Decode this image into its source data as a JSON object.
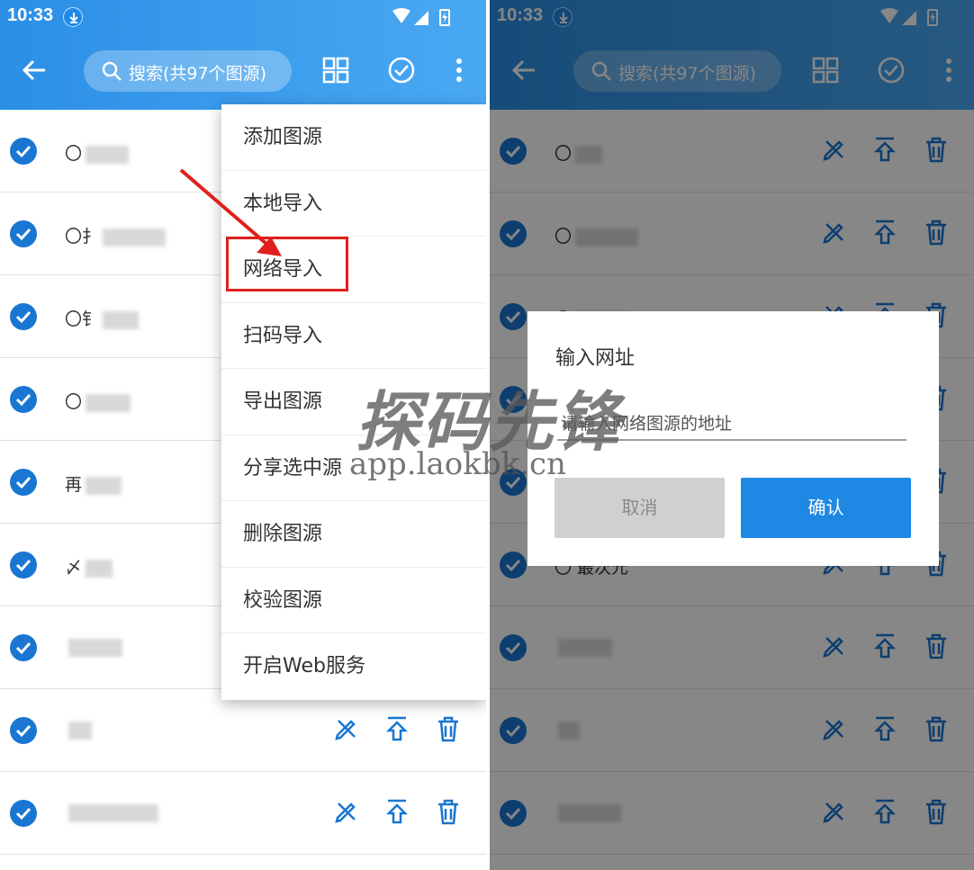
{
  "status": {
    "time": "10:33"
  },
  "search": {
    "placeholder": "搜索(共97个图源)"
  },
  "menu": {
    "items": [
      {
        "label": "添加图源"
      },
      {
        "label": "本地导入"
      },
      {
        "label": "网络导入"
      },
      {
        "label": "扫码导入"
      },
      {
        "label": "导出图源"
      },
      {
        "label": "分享选中源"
      },
      {
        "label": "删除图源"
      },
      {
        "label": "校验图源"
      },
      {
        "label": "开启Web服务"
      }
    ]
  },
  "left_rows": [
    {
      "name": "〇"
    },
    {
      "name": "〇扌"
    },
    {
      "name": "〇钅"
    },
    {
      "name": "〇"
    },
    {
      "name": "再"
    },
    {
      "name": "〆"
    },
    {
      "name": ""
    },
    {
      "name": ""
    },
    {
      "name": ""
    }
  ],
  "right_rows": [
    {
      "name": "〇"
    },
    {
      "name": "〇"
    },
    {
      "name": "〇"
    },
    {
      "name": ""
    },
    {
      "name": ""
    },
    {
      "name": "〇 最次元"
    },
    {
      "name": ""
    },
    {
      "name": ""
    },
    {
      "name": ""
    }
  ],
  "dialog": {
    "title": "输入网址",
    "placeholder": "请输入网络图源的地址",
    "cancel": "取消",
    "confirm": "确认"
  },
  "watermark": {
    "brand": "探码先锋",
    "url": "app.laokbk.cn"
  },
  "colors": {
    "appbar": "#2b8fe6",
    "accent": "#1976d2",
    "highlight": "#e0201c"
  }
}
